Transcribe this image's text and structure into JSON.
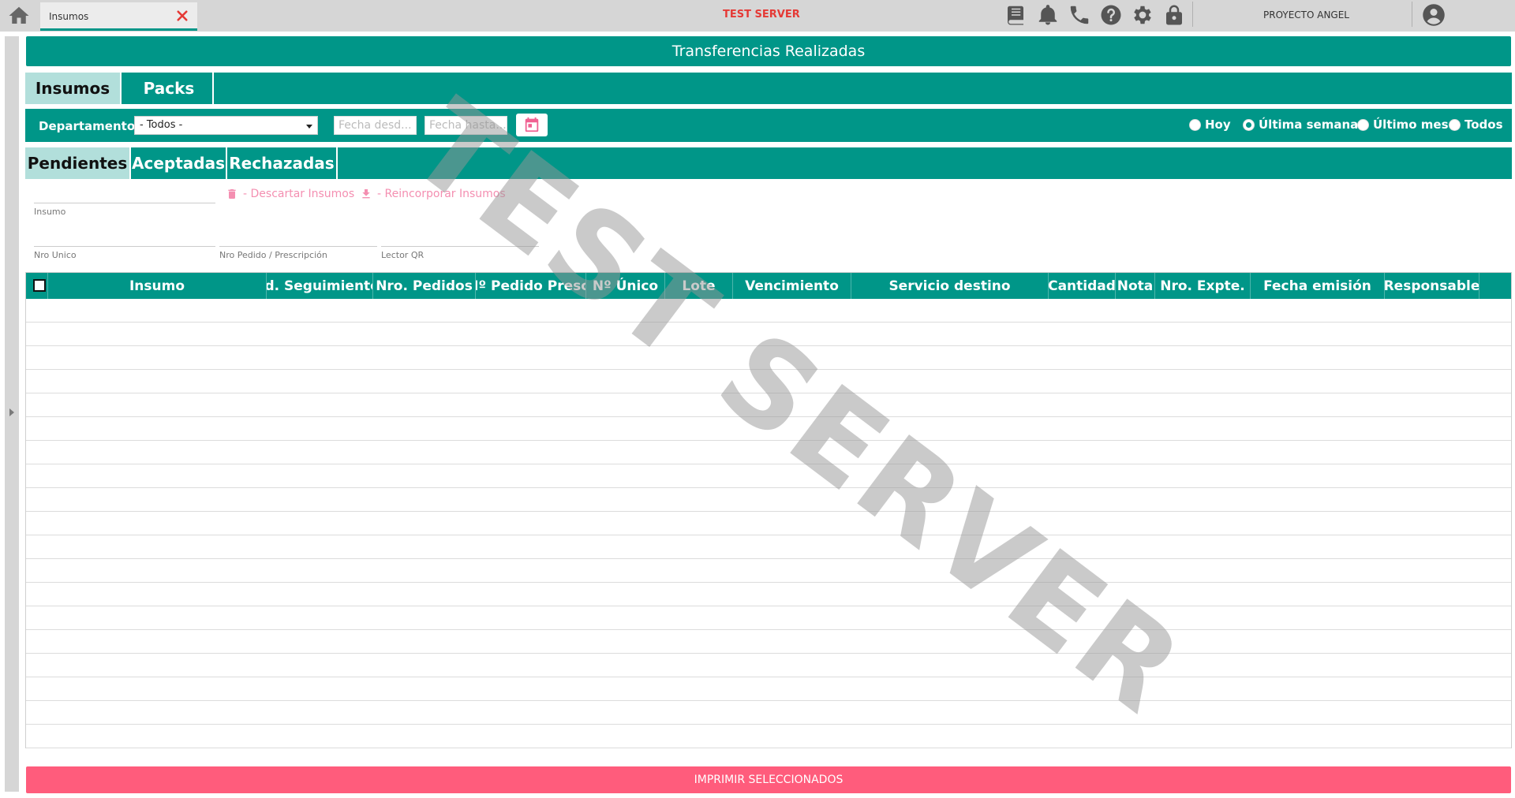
{
  "topbar": {
    "tab_label": "Insumos",
    "server_label": "TEST SERVER",
    "project_label": "PROYECTO ANGEL",
    "icons": [
      "home-icon",
      "book-icon",
      "bell-icon",
      "phone-icon",
      "help-icon",
      "gear-icon",
      "lock-icon",
      "user-icon"
    ]
  },
  "page": {
    "title": "Transferencias Realizadas"
  },
  "main_tabs": [
    {
      "label": "Insumos",
      "active": true
    },
    {
      "label": "Packs",
      "active": false
    }
  ],
  "filters": {
    "departments_label": "Departamentos",
    "departments_value": "- Todos -",
    "date_from_placeholder": "Fecha desd...",
    "date_to_placeholder": "Fecha hasta...",
    "radios": [
      {
        "label": "Hoy",
        "checked": false
      },
      {
        "label": "Última semana",
        "checked": true
      },
      {
        "label": "Último mes",
        "checked": false
      },
      {
        "label": "Todos",
        "checked": false
      }
    ]
  },
  "sub_tabs": [
    {
      "label": "Pendientes",
      "active": true
    },
    {
      "label": "Aceptadas",
      "active": false
    },
    {
      "label": "Rechazadas",
      "active": false
    }
  ],
  "search": {
    "insumo_label": "Insumo",
    "nro_unico_label": "Nro Unico",
    "nro_pedido_label": "Nro Pedido / Prescripción",
    "lector_qr_label": "Lector QR"
  },
  "actions": {
    "descartar": "- Descartar Insumos",
    "reincorporar": "- Reincorporar Insumos"
  },
  "grid": {
    "columns": [
      "Insumo",
      "Id. Seguimiento",
      "Nro. Pedidos",
      "Nº Pedido Presc.",
      "Nº Único",
      "Lote",
      "Vencimiento",
      "Servicio destino",
      "Cantidad",
      "Nota",
      "Nro. Expte.",
      "Fecha emisión",
      "Responsable"
    ],
    "rows": []
  },
  "footer": {
    "print_label": "IMPRIMIR SELECCIONADOS"
  },
  "watermark": "TEST SERVER",
  "colors": {
    "primary": "#009688",
    "active_tab": "#b2dfdb",
    "print_button": "#ff5c7c",
    "server_label": "#e53935",
    "action_link": "#f48fb1"
  }
}
